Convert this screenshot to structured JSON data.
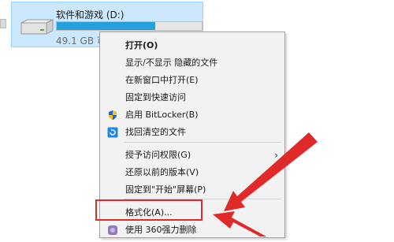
{
  "drive": {
    "name": "软件和游戏 (D:)",
    "free_text": "49.1 GB 可",
    "usage_fraction": 0.68
  },
  "context_menu": {
    "items": [
      {
        "label": "打开(O)",
        "bold": true
      },
      {
        "label": "显示/不显示 隐藏的文件"
      },
      {
        "label": "在新窗口中打开(E)"
      },
      {
        "label": "固定到快速访问"
      },
      {
        "label": "启用 BitLocker(B)",
        "icon": "shield-icon"
      },
      {
        "label": "找回清空的文件",
        "icon": "recover-icon"
      },
      {
        "label": "授予访问权限(G)",
        "has_submenu": true
      },
      {
        "label": "还原以前的版本(V)"
      },
      {
        "label": "固定到\"开始\"屏幕(P)"
      },
      {
        "label": "格式化(A)...",
        "highlighted": true
      },
      {
        "label": "使用 360强力删除",
        "icon": "360-icon"
      }
    ],
    "submenu_arrow": "›"
  },
  "colors": {
    "selection_bg": "#cce8ff",
    "bar_fill": "#26a0da",
    "annotation_red": "#e02a2a",
    "menu_bg": "#f2f2f2"
  }
}
